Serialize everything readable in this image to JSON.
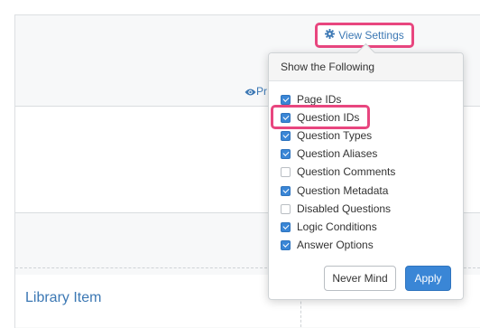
{
  "toolbar": {
    "view_settings_label": "View Settings",
    "preview_label": "Pr"
  },
  "library": {
    "item_title": "Library Item"
  },
  "popover": {
    "header": "Show the Following",
    "options": [
      {
        "label": "Page IDs",
        "checked": true
      },
      {
        "label": "Question IDs",
        "checked": true
      },
      {
        "label": "Question Types",
        "checked": true
      },
      {
        "label": "Question Aliases",
        "checked": true
      },
      {
        "label": "Question Comments",
        "checked": false
      },
      {
        "label": "Question Metadata",
        "checked": true
      },
      {
        "label": "Disabled Questions",
        "checked": false
      },
      {
        "label": "Logic Conditions",
        "checked": true
      },
      {
        "label": "Answer Options",
        "checked": true
      }
    ],
    "cancel_label": "Never Mind",
    "apply_label": "Apply"
  },
  "colors": {
    "accent": "#3a86d6",
    "link": "#3c78b4",
    "highlight": "#e8467f"
  }
}
